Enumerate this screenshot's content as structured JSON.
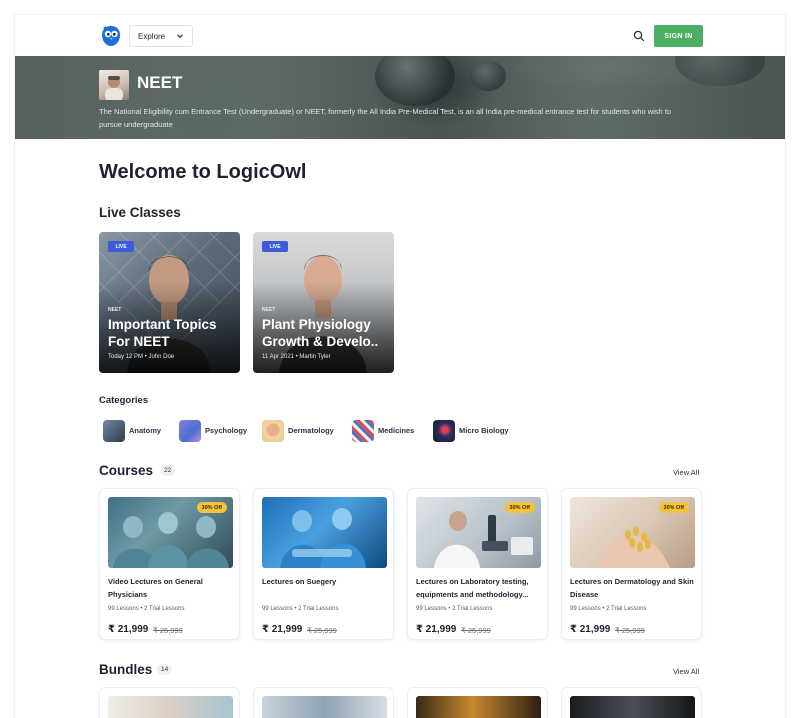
{
  "header": {
    "explore_label": "Explore",
    "signin_label": "SIGN IN"
  },
  "banner": {
    "title": "NEET",
    "description": "The National Eligibility cum Entrance Test (Undergraduate) or NEET, formerly the All India Pre-Medical Test, is an all India pre-medical entrance test for students who wish to pursue undergraduate"
  },
  "welcome": "Welcome to LogicOwl",
  "live": {
    "title": "Live Classes",
    "cards": [
      {
        "badge": "LIVE",
        "category": "NEET",
        "title": "Important Topics For NEET",
        "meta": "Today 12 PM • John Doe"
      },
      {
        "badge": "LIVE",
        "category": "NEET",
        "title": "Plant Physiology Growth & Develo..",
        "meta": "11 Apr 2021 • Martin Tyler"
      }
    ]
  },
  "categories": {
    "title": "Categories",
    "items": [
      {
        "label": "Anatomy",
        "icon": "anatomy-icon"
      },
      {
        "label": "Psychology",
        "icon": "psychology-icon"
      },
      {
        "label": "Dermatology",
        "icon": "dermatology-icon"
      },
      {
        "label": "Medicines",
        "icon": "medicines-icon"
      },
      {
        "label": "Micro Biology",
        "icon": "micro-biology-icon"
      }
    ]
  },
  "courses": {
    "title": "Courses",
    "count": "22",
    "view_all": "View All",
    "items": [
      {
        "badge": "30% Off",
        "title": "Video Lectures on General Physicians",
        "lessons": "99 Lessons • 2 Trial Lessons",
        "price": "₹ 21,999",
        "old_price": "₹ 25,999"
      },
      {
        "badge": "",
        "title": "Lectures on Suegery",
        "lessons": "99 Lessons • 2 Trial Lessons",
        "price": "₹ 21,999",
        "old_price": "₹ 25,999"
      },
      {
        "badge": "30% Off",
        "title": "Lectures on Laboratory testing, equipments and methodology...",
        "lessons": "99 Lessons • 2 Trial Lessons",
        "price": "₹ 21,999",
        "old_price": "₹ 25,999"
      },
      {
        "badge": "30% Off",
        "title": "Lectures on Dermatology and Skin Disease",
        "lessons": "99 Lessons • 2 Trial Lessons",
        "price": "₹ 21,999",
        "old_price": "₹ 25,999"
      }
    ]
  },
  "bundles": {
    "title": "Bundles",
    "count": "14",
    "view_all": "View All"
  },
  "colors": {
    "accent_green": "#4caf63",
    "live_badge": "#3d5adb",
    "discount_badge": "#f5c23b"
  }
}
